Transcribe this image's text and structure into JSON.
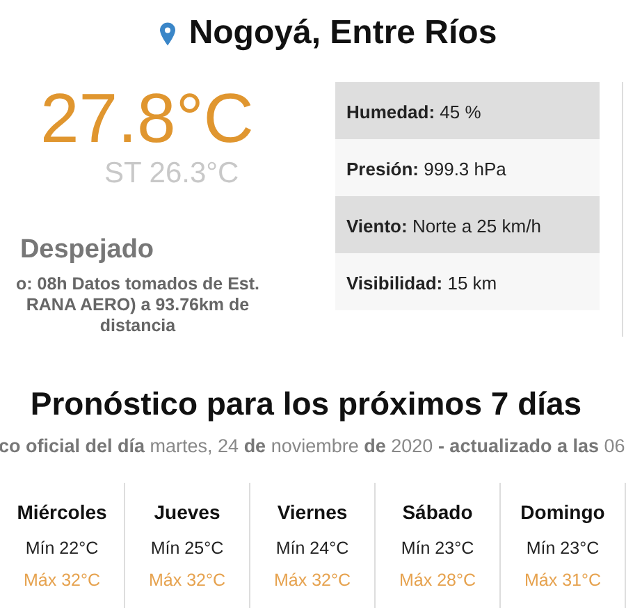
{
  "location": {
    "title": "Nogoyá, Entre Ríos"
  },
  "current": {
    "temperature": "27.8°C",
    "feels_like": "ST 26.3°C",
    "condition": "Despejado",
    "station_lines": [
      "o: 08h Datos tomados de Est.",
      "RANA AERO) a 93.76km de",
      "distancia"
    ]
  },
  "details": [
    {
      "label": "Humedad:",
      "value": "45 %"
    },
    {
      "label": "Presión:",
      "value": "999.3 hPa"
    },
    {
      "label": "Viento:",
      "value": "Norte a 25 km/h"
    },
    {
      "label": "Visibilidad:",
      "value": "15 km"
    }
  ],
  "forecast": {
    "title": "Pronóstico para los próximos 7 días",
    "subtitle": "**co oficial del día** martes, 24 **de** noviembre **de** 2020 **- actualizado a las** 06",
    "days": [
      {
        "day": "Miércoles",
        "min": "Mín 22°C",
        "max": "Máx 32°C"
      },
      {
        "day": "Jueves",
        "min": "Mín 25°C",
        "max": "Máx 32°C"
      },
      {
        "day": "Viernes",
        "min": "Mín 24°C",
        "max": "Máx 32°C"
      },
      {
        "day": "Sábado",
        "min": "Mín 23°C",
        "max": "Máx 28°C"
      },
      {
        "day": "Domingo",
        "min": "Mín 23°C",
        "max": "Máx 31°C"
      }
    ]
  }
}
